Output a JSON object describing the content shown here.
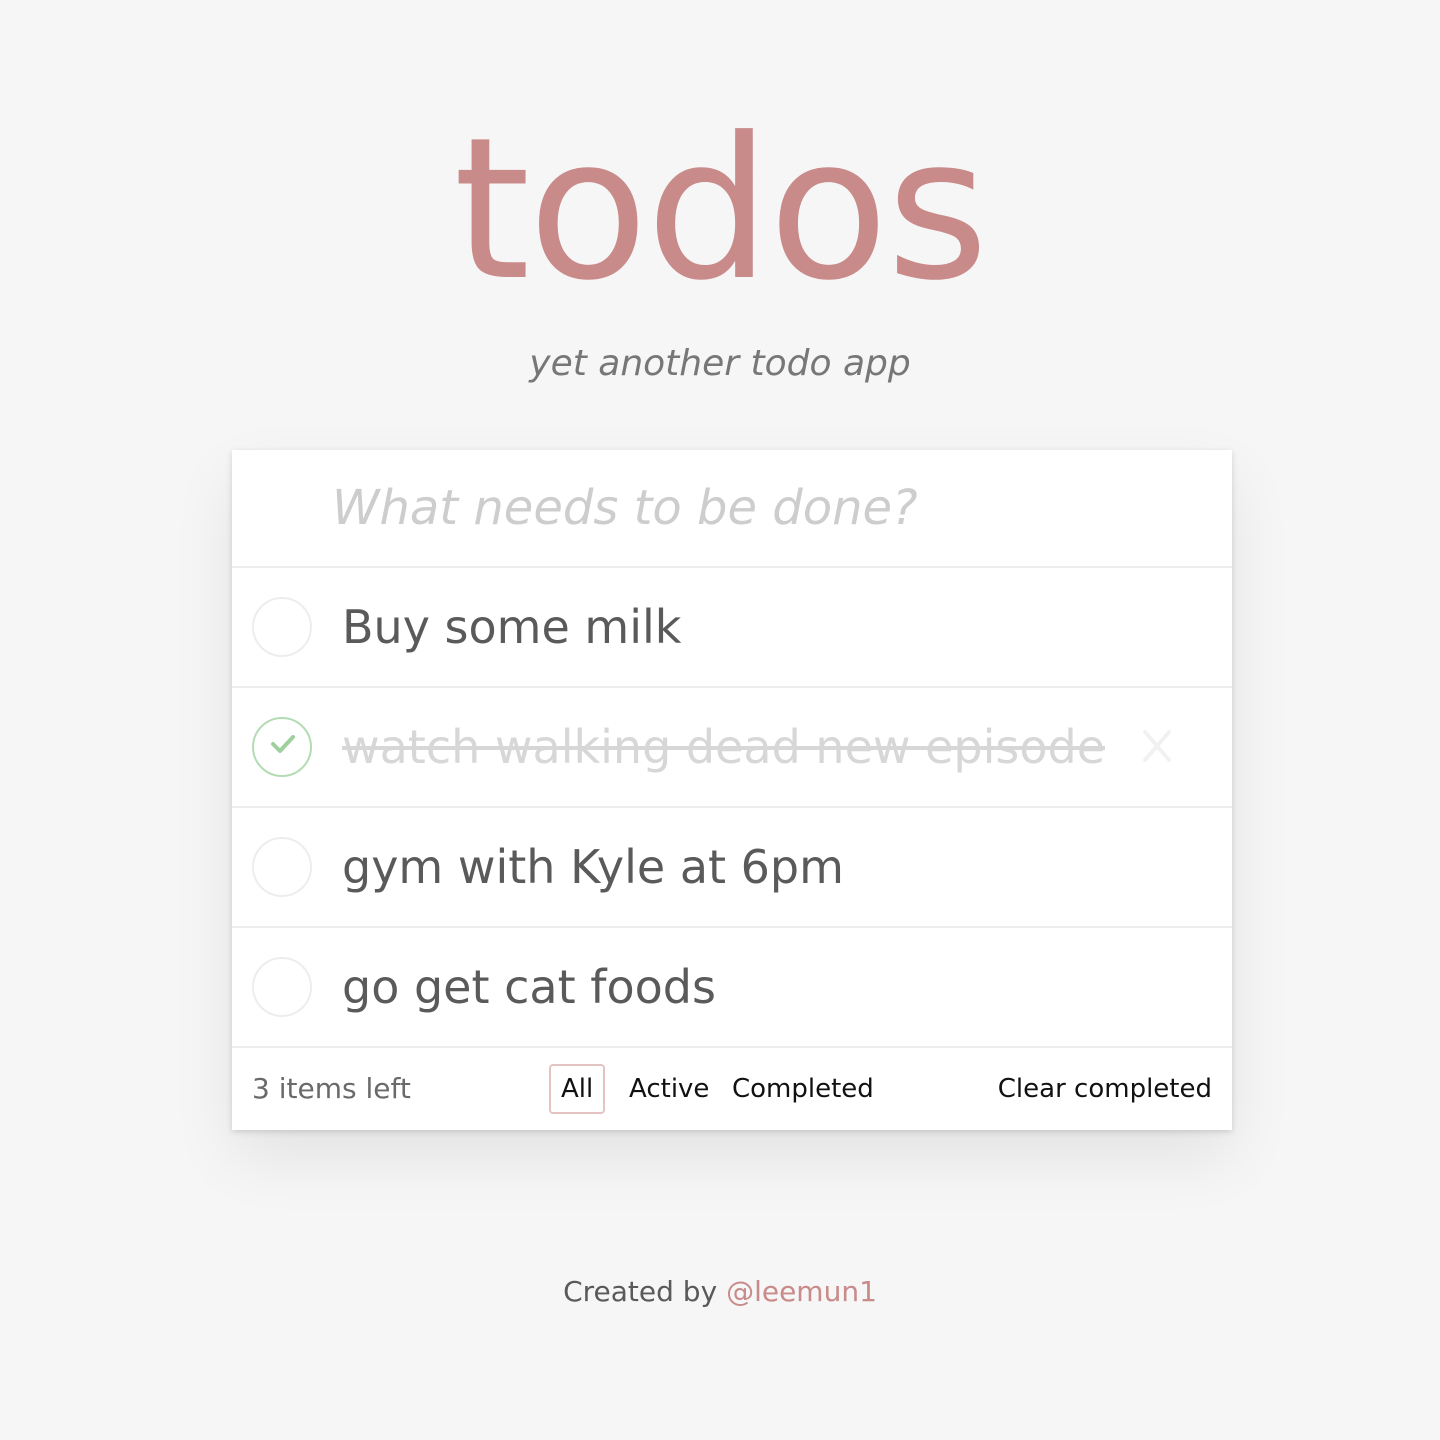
{
  "header": {
    "title": "todos",
    "subtitle": "yet another todo app"
  },
  "new_todo": {
    "placeholder": "What needs to be done?",
    "value": ""
  },
  "todos": [
    {
      "label": "Buy some milk",
      "completed": false
    },
    {
      "label": "watch walking dead new episode",
      "completed": true,
      "delete_icon": "close-icon"
    },
    {
      "label": "gym with Kyle at 6pm",
      "completed": false
    },
    {
      "label": "go get cat foods",
      "completed": false
    }
  ],
  "footer": {
    "items_left": "3 items left",
    "filters": [
      {
        "label": "All",
        "selected": true
      },
      {
        "label": "Active",
        "selected": false
      },
      {
        "label": "Completed",
        "selected": false
      }
    ],
    "clear_completed": "Clear completed"
  },
  "credits": {
    "prefix": "Created by",
    "link_text": "@leemun1"
  },
  "colors": {
    "background": "#f6f6f6",
    "accent": "#c98a8a",
    "check_green": "#9ed09e",
    "text": "#5a5a5a",
    "completed_text": "#d7d7d7"
  }
}
